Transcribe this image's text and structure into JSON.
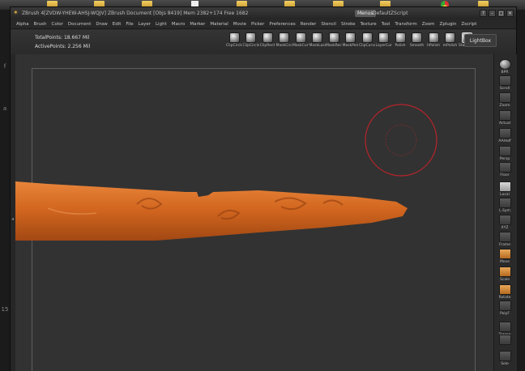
{
  "desktop": {
    "edge_marks": [
      "f",
      "a",
      "15"
    ]
  },
  "window": {
    "title": "ZBrush 4[ZVDW-YHEW-AHSJ-WQJV]   ZBrush Document    [Objs 8419]  Mem 2382+174  Free 1682",
    "menus_badge": "Menus",
    "script_name": "DefaultZScript",
    "buttons": [
      "?",
      "-",
      "□",
      "×"
    ]
  },
  "menubar": {
    "items": [
      "Alpha",
      "Brush",
      "Color",
      "Document",
      "Draw",
      "Edit",
      "File",
      "Layer",
      "Light",
      "Macro",
      "Marker",
      "Material",
      "Movie",
      "Picker",
      "Preferences",
      "Render",
      "Stencil",
      "Stroke",
      "Texture",
      "Tool",
      "Transform",
      "Zoom",
      "Zplugin",
      "Zscript"
    ]
  },
  "toolbar": {
    "total_points": "TotalPoints: 18.667 Mil",
    "active_points": "ActivePoints: 2.256 Mil",
    "brushes": [
      {
        "label": "ClipCircle",
        "selected": false
      },
      {
        "label": "ClipCircleCenter",
        "selected": false
      },
      {
        "label": "ClipRect",
        "selected": false
      },
      {
        "label": "MaskCircle",
        "selected": false
      },
      {
        "label": "MaskCurve",
        "selected": false
      },
      {
        "label": "MaskLasso",
        "selected": false
      },
      {
        "label": "MaskRect",
        "selected": false
      },
      {
        "label": "MaskPen",
        "selected": false
      },
      {
        "label": "ClipCurve",
        "selected": false
      },
      {
        "label": "LayerCurve",
        "selected": false
      },
      {
        "label": "Polish",
        "selected": false
      },
      {
        "label": "Smooth",
        "selected": false
      },
      {
        "label": "hPolish",
        "selected": false
      },
      {
        "label": "mPolish",
        "selected": false
      },
      {
        "label": "Standard",
        "selected": true
      }
    ],
    "lightbox_label": "LightBox"
  },
  "right_shelf": {
    "tools": [
      {
        "name": "bpr",
        "label": "BPR",
        "icon": "render-sphere-icon"
      },
      {
        "name": "scroll",
        "label": "Scroll",
        "icon": "scroll-icon"
      },
      {
        "name": "zoom",
        "label": "Zoom",
        "icon": "zoom-icon"
      },
      {
        "name": "actual",
        "label": "Actual",
        "icon": "actual-icon"
      },
      {
        "name": "aahalf",
        "label": "AAHalf",
        "icon": "aahalf-icon"
      },
      {
        "name": "persp",
        "label": "Persp",
        "icon": "persp-icon"
      },
      {
        "name": "floor",
        "label": "Floor",
        "icon": "floor-icon"
      },
      {
        "name": "local",
        "label": "Local",
        "icon": "local-icon"
      },
      {
        "name": "lsym",
        "label": "L.Sym",
        "icon": "lsym-icon"
      },
      {
        "name": "xyz",
        "label": "XYZ",
        "icon": "axis-icon"
      },
      {
        "name": "frame",
        "label": "Frame",
        "icon": "frame-icon"
      },
      {
        "name": "move",
        "label": "Move",
        "icon": "move-icon"
      },
      {
        "name": "scale",
        "label": "Scale",
        "icon": "scale-icon"
      },
      {
        "name": "rotate",
        "label": "Rotate",
        "icon": "rotate-icon"
      },
      {
        "name": "polyf",
        "label": "PolyF",
        "icon": "polyframe-icon"
      },
      {
        "name": "transp",
        "label": "Transp",
        "icon": "transparency-icon"
      },
      {
        "name": "ghost",
        "label": "",
        "icon": "ghost-icon"
      },
      {
        "name": "solo",
        "label": "Solo",
        "icon": "solo-icon"
      }
    ]
  },
  "colors": {
    "model": "#d2661f",
    "brush_ring": "#b8242b",
    "canvas": "#323232"
  }
}
